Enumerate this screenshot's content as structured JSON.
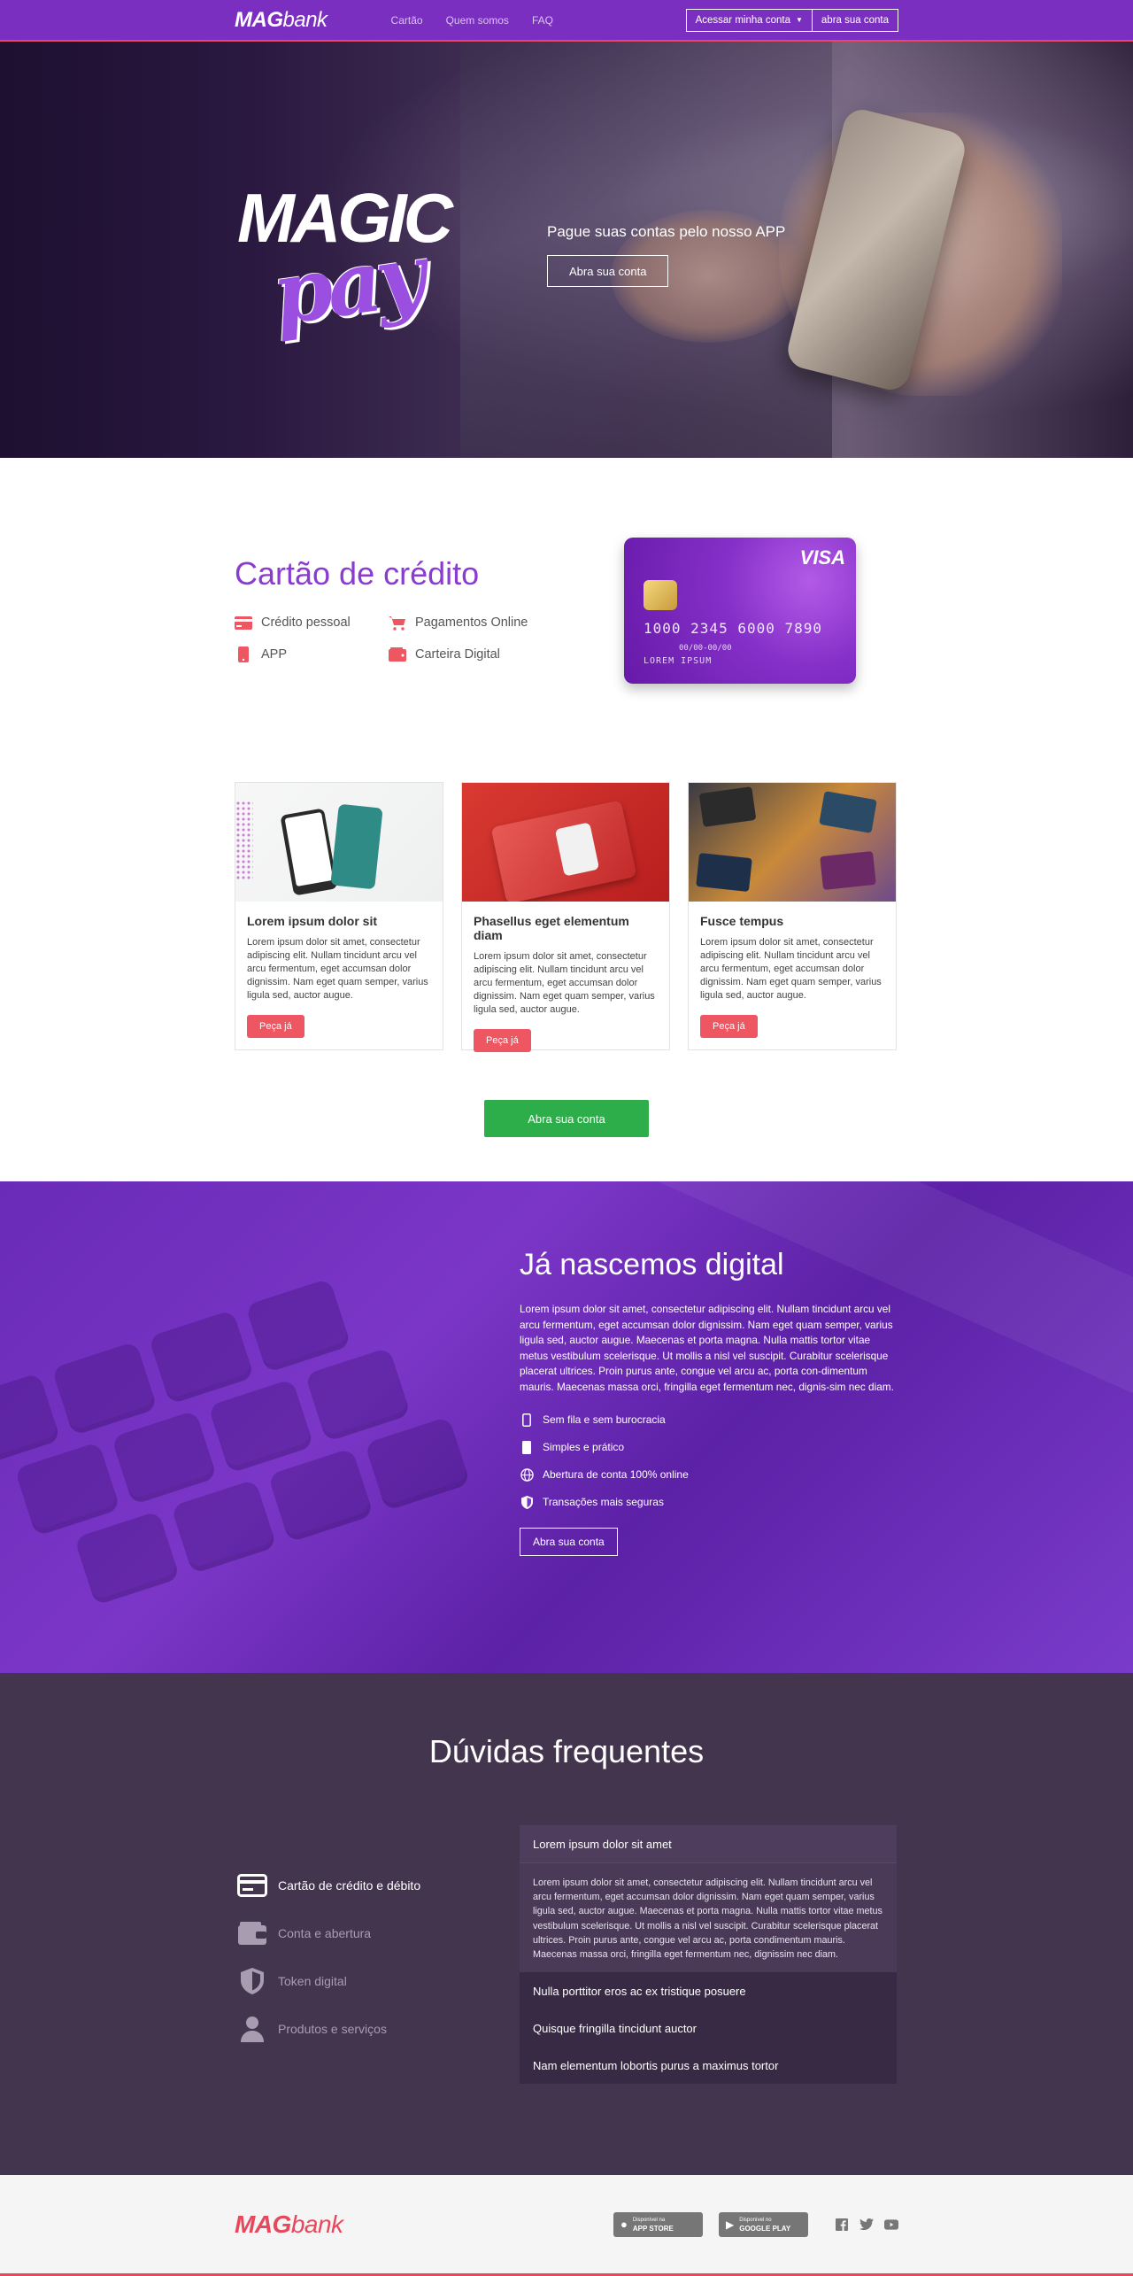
{
  "nav": {
    "logo_bold": "MAG",
    "logo_light": "bank",
    "links": [
      "Cartão",
      "Quem somos",
      "FAQ"
    ],
    "account_button": "Acessar minha conta",
    "open_account_button": "abra sua conta"
  },
  "hero": {
    "logo_top": "MAGIC",
    "logo_bottom": "pay",
    "tagline": "Pague suas contas pelo nosso APP",
    "button": "Abra sua conta"
  },
  "credit": {
    "title": "Cartão de crédito",
    "features": [
      {
        "label": "Crédito pessoal",
        "icon": "credit-card-icon"
      },
      {
        "label": "Pagamentos Online",
        "icon": "cart-icon"
      },
      {
        "label": "APP",
        "icon": "phone-icon"
      },
      {
        "label": "Carteira Digital",
        "icon": "wallet-icon"
      }
    ],
    "card": {
      "brand": "VISA",
      "number": "1000 2345 6000 7890",
      "validity": "00/00-00/00",
      "holder": "LOREM IPSUM"
    }
  },
  "products": {
    "cards": [
      {
        "title": "Lorem ipsum dolor sit",
        "text": "Lorem ipsum dolor sit amet, consectetur adipiscing elit. Nullam tincidunt arcu vel arcu fermentum, eget accumsan dolor dignissim. Nam eget quam semper, varius ligula sed, auctor augue.",
        "button": "Peça já"
      },
      {
        "title": "Phasellus eget elementum diam",
        "text": "Lorem ipsum dolor sit amet, consectetur adipiscing elit. Nullam tincidunt arcu vel arcu fermentum, eget accumsan dolor dignissim. Nam eget quam semper, varius ligula sed, auctor augue.",
        "button": "Peça já"
      },
      {
        "title": "Fusce tempus",
        "text": "Lorem ipsum dolor sit amet, consectetur adipiscing elit. Nullam tincidunt arcu vel arcu fermentum, eget accumsan dolor dignissim. Nam eget quam semper, varius ligula sed, auctor augue.",
        "button": "Peça já"
      }
    ],
    "cta": "Abra sua conta"
  },
  "digital": {
    "title": "Já nascemos digital",
    "text": "Lorem ipsum dolor sit amet, consectetur adipiscing elit. Nullam tincidunt arcu vel arcu fermentum, eget accumsan dolor dignissim. Nam eget quam semper, varius ligula sed, auctor augue. Maecenas et porta magna. Nulla mattis tortor vitae metus vestibulum scelerisque. Ut mollis a nisl vel suscipit. Curabitur scelerisque placerat ultrices. Proin purus ante, congue vel arcu ac, porta con-dimentum mauris. Maecenas massa orci, fringilla eget fermentum nec, dignis-sim nec diam.",
    "items": [
      {
        "label": "Sem fila e sem burocracia",
        "icon": "phone-icon"
      },
      {
        "label": "Simples e prático",
        "icon": "mobile-icon"
      },
      {
        "label": "Abertura de conta 100% online",
        "icon": "globe-icon"
      },
      {
        "label": "Transações mais seguras",
        "icon": "shield-icon"
      }
    ],
    "button": "Abra sua conta"
  },
  "faq": {
    "title": "Dúvidas frequentes",
    "categories": [
      {
        "label": "Cartão de crédito e débito",
        "icon": "credit-card-icon",
        "active": true
      },
      {
        "label": "Conta e abertura",
        "icon": "wallet-icon",
        "active": false
      },
      {
        "label": "Token digital",
        "icon": "shield-icon",
        "active": false
      },
      {
        "label": "Produtos e serviços",
        "icon": "user-icon",
        "active": false
      }
    ],
    "questions": [
      "Lorem ipsum dolor sit amet",
      "Nulla porttitor eros ac ex tristique posuere",
      "Quisque fringilla tincidunt auctor",
      "Nam elementum lobortis purus a maximus tortor"
    ],
    "answer": "Lorem ipsum dolor sit amet, consectetur adipiscing elit. Nullam tincidunt arcu vel arcu fermentum, eget accumsan dolor dignissim. Nam eget quam semper, varius ligula sed, auctor augue. Maecenas et porta magna. Nulla mattis tortor vitae metus vestibulum scelerisque. Ut mollis a nisl vel suscipit. Curabitur scelerisque placerat ultrices. Proin purus ante, congue vel arcu ac, porta condimentum mauris. Maecenas massa orci, fringilla eget fermentum nec, dignissim nec diam."
  },
  "footer": {
    "logo_bold": "MAG",
    "logo_light": "bank",
    "app_store_small": "Disponível na",
    "app_store": "APP STORE",
    "google_play_small": "Disponível no",
    "google_play": "GOOGLE PLAY",
    "social": [
      "facebook-icon",
      "twitter-icon",
      "youtube-icon"
    ]
  },
  "colors": {
    "brand_purple": "#7b2fc0",
    "accent_red": "#e8475c",
    "cta_green": "#2eae4a",
    "faq_bg": "#44354f"
  }
}
